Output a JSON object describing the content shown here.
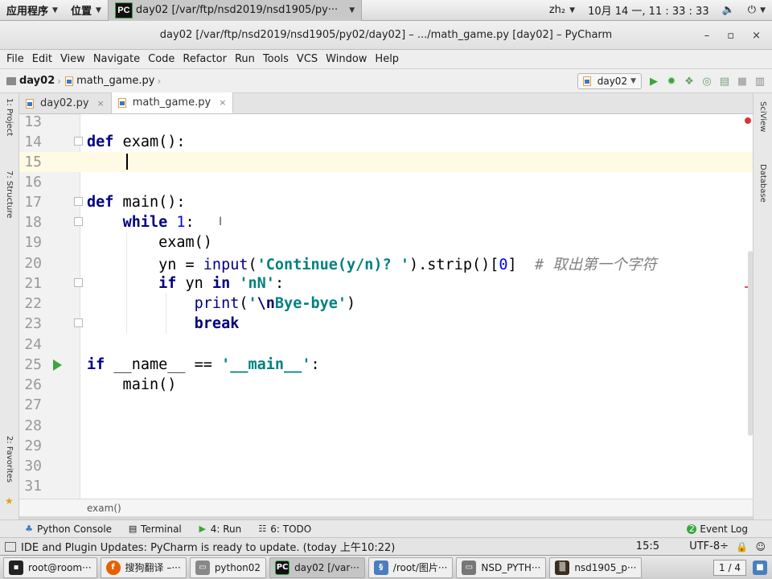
{
  "top_panel": {
    "apps_label": "应用程序",
    "places_label": "位置",
    "window_label": "day02 [/var/ftp/nsd2019/nsd1905/py···",
    "input_method": "zh₂",
    "datetime": "10月 14 一, 11 : 33 : 33"
  },
  "window": {
    "title": "day02 [/var/ftp/nsd2019/nsd1905/py02/day02] – .../math_game.py [day02] – PyCharm",
    "minimize": "–",
    "maximize": "▫",
    "close": "×"
  },
  "menu": [
    "File",
    "Edit",
    "View",
    "Navigate",
    "Code",
    "Refactor",
    "Run",
    "Tools",
    "VCS",
    "Window",
    "Help"
  ],
  "nav": {
    "project": "day02",
    "file": "math_game.py",
    "run_config": "day02"
  },
  "tabs": [
    {
      "label": "day02.py"
    },
    {
      "label": "math_game.py"
    }
  ],
  "editor": {
    "line_numbers": [
      "13",
      "14",
      "15",
      "16",
      "17",
      "18",
      "19",
      "20",
      "21",
      "22",
      "23",
      "24",
      "25",
      "26",
      "27",
      "28",
      "29",
      "30",
      "31"
    ],
    "comment_line20": "# 取出第一个字符",
    "breadcrumb": "exam()"
  },
  "tool_windows": {
    "python_console": "Python Console",
    "terminal": "Terminal",
    "run": "4: Run",
    "todo": "6: TODO",
    "event_log": "Event Log"
  },
  "status": {
    "message": "IDE and Plugin Updates: PyCharm is ready to update. (today 上午10:22)",
    "position": "15:5",
    "encoding": "UTF-8÷"
  },
  "taskbar": {
    "items": [
      "root@room···",
      "搜狗翻译 –···",
      "python02",
      "day02 [/var···",
      "/root/图片···",
      "NSD_PYTH···",
      "nsd1905_p···"
    ],
    "workspace": "1 / 4"
  }
}
